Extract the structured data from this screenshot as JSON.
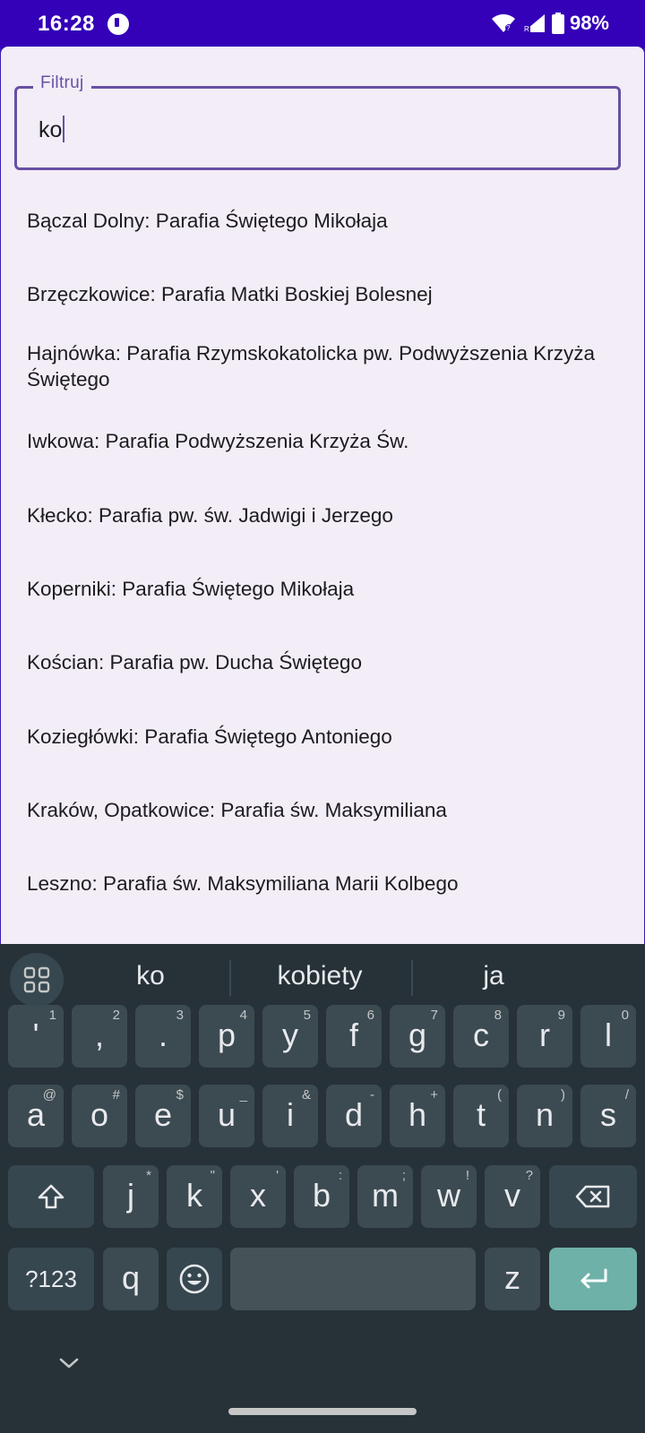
{
  "status_bar": {
    "time": "16:28",
    "battery": "98%"
  },
  "filter": {
    "label": "Filtruj",
    "value": "ko"
  },
  "results": [
    "Bączal Dolny: Parafia Świętego Mikołaja",
    "Brzęczkowice: Parafia Matki Boskiej Bolesnej",
    "Hajnówka: Parafia Rzymskokatolicka pw. Podwyższenia Krzyża Świętego",
    "Iwkowa: Parafia Podwyższenia Krzyża Św.",
    "Kłecko: Parafia pw. św. Jadwigi i Jerzego",
    "Koperniki: Parafia Świętego Mikołaja",
    "Kościan: Parafia pw. Ducha Świętego",
    "Koziegłówki: Parafia Świętego Antoniego",
    "Kraków, Opatkowice: Parafia św. Maksymiliana",
    "Leszno: Parafia św. Maksymiliana Marii Kolbego"
  ],
  "keyboard": {
    "suggestions": [
      "ko",
      "kobiety",
      "ja"
    ],
    "row1": [
      {
        "k": "'",
        "h": "1"
      },
      {
        "k": ",",
        "h": "2"
      },
      {
        "k": ".",
        "h": "3"
      },
      {
        "k": "p",
        "h": "4"
      },
      {
        "k": "y",
        "h": "5"
      },
      {
        "k": "f",
        "h": "6"
      },
      {
        "k": "g",
        "h": "7"
      },
      {
        "k": "c",
        "h": "8"
      },
      {
        "k": "r",
        "h": "9"
      },
      {
        "k": "l",
        "h": "0"
      }
    ],
    "row2": [
      {
        "k": "a",
        "h": "@"
      },
      {
        "k": "o",
        "h": "#"
      },
      {
        "k": "e",
        "h": "$"
      },
      {
        "k": "u",
        "h": "_"
      },
      {
        "k": "i",
        "h": "&"
      },
      {
        "k": "d",
        "h": "-"
      },
      {
        "k": "h",
        "h": "+"
      },
      {
        "k": "t",
        "h": "("
      },
      {
        "k": "n",
        "h": ")"
      },
      {
        "k": "s",
        "h": "/"
      }
    ],
    "row3": [
      {
        "k": "j",
        "h": "*"
      },
      {
        "k": "k",
        "h": "\""
      },
      {
        "k": "x",
        "h": "'"
      },
      {
        "k": "b",
        "h": ":"
      },
      {
        "k": "m",
        "h": ";"
      },
      {
        "k": "w",
        "h": "!"
      },
      {
        "k": "v",
        "h": "?"
      }
    ],
    "row4": {
      "symbols": "?123",
      "q": "q",
      "z": "z"
    }
  },
  "colors": {
    "accent": "#6750a4",
    "status_bar": "#3400b8",
    "enter": "#6eb1a8"
  }
}
